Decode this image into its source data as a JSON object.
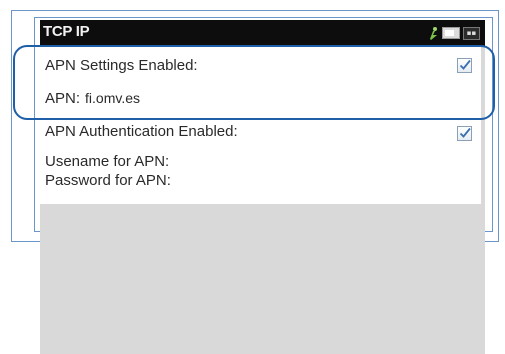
{
  "header": {
    "title": "TCP IP",
    "icons": [
      "signal-icon",
      "battery-icon",
      "notification-icon"
    ],
    "notification_glyph": "▪▪"
  },
  "settings": {
    "apn_settings_enabled": {
      "label": "APN Settings Enabled:",
      "checked": true
    },
    "apn": {
      "label": "APN:",
      "value": "fi.omv.es"
    },
    "apn_authentication_enabled": {
      "label": "APN Authentication Enabled:",
      "checked": true
    },
    "username": {
      "label": "Usename for APN:"
    },
    "password": {
      "label": "Password for APN:"
    }
  },
  "colors": {
    "status_bar": "#0d0d0d",
    "highlight": "#1f5fa8",
    "check_mark": "#3a6fb0",
    "signal": "#7cc24a"
  }
}
